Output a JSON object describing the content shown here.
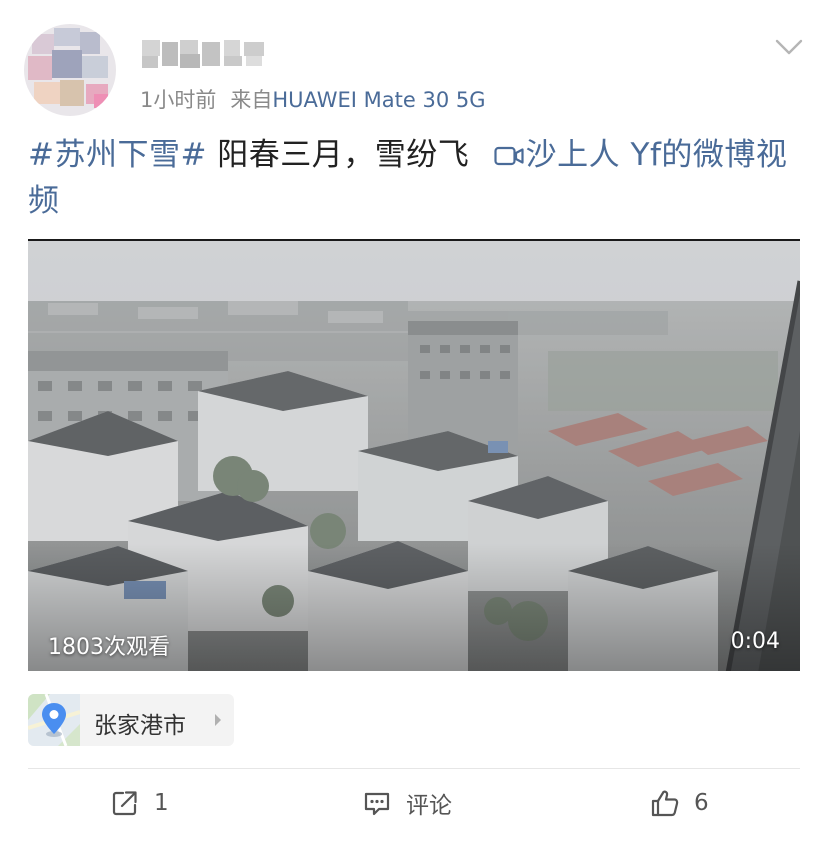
{
  "post": {
    "author": {
      "avatar_icon": "avatar-icon-blurred",
      "name_blurred": true
    },
    "time": "1小时前",
    "source_prefix": "来自",
    "device": "HUAWEI Mate 30 5G",
    "more_icon": "chevron-down-icon",
    "text": {
      "hashtag": "#苏州下雪#",
      "body": " 阳春三月，雪纷飞 ",
      "video_link": "沙上人 Yf的微博视频",
      "video_link_icon": "video-camera-icon"
    },
    "video": {
      "views": "1803次观看",
      "duration": "0:04"
    },
    "location": {
      "icon": "map-pin-icon",
      "name": "张家港市"
    },
    "actions": {
      "share_count": "1",
      "comment_label": "评论",
      "like_count": "6"
    },
    "colors": {
      "link": "#4a6b98",
      "meta": "#8a8a8a",
      "text": "#222222"
    }
  }
}
